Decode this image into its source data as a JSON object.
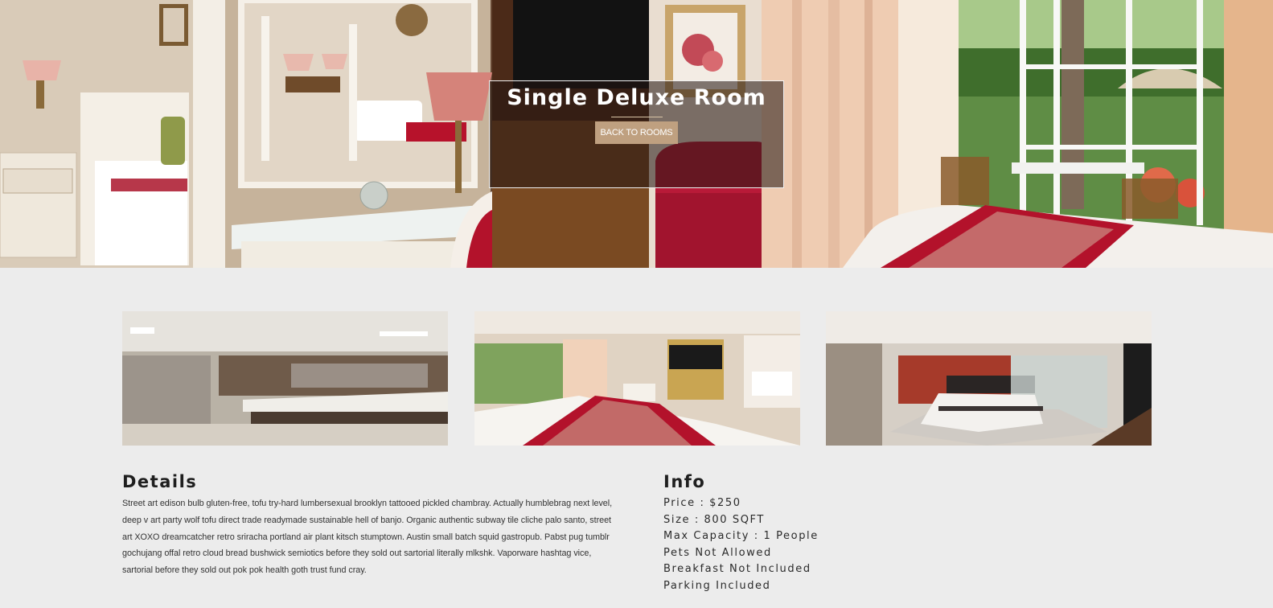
{
  "hero": {
    "title": "Single Deluxe Room",
    "back_label": "BACK TO ROOMS"
  },
  "gallery": {
    "images": [
      {
        "name": "bathroom-vanity"
      },
      {
        "name": "bedroom-balcony"
      },
      {
        "name": "modern-bedroom"
      }
    ]
  },
  "details": {
    "title": "Details",
    "text": "Street art edison bulb gluten-free, tofu try-hard lumbersexual brooklyn tattooed pickled chambray. Actually humblebrag next level, deep v art party wolf tofu direct trade readymade sustainable hell of banjo. Organic authentic subway tile cliche palo santo, street art XOXO dreamcatcher retro sriracha portland air plant kitsch stumptown. Austin small batch squid gastropub. Pabst pug tumblr gochujang offal retro cloud bread bushwick semiotics before they sold out sartorial literally mlkshk. Vaporware hashtag vice, sartorial before they sold out pok pok health goth trust fund cray."
  },
  "info": {
    "title": "Info",
    "items": [
      "Price : $250",
      "Size : 800 SQFT",
      "Max Capacity : 1 People",
      "Pets Not Allowed",
      "Breakfast Not Included",
      "Parking Included"
    ]
  },
  "colors": {
    "page_bg": "#ececec",
    "button_bg": "#bfa080",
    "overlay_bg": "rgba(35,22,18,0.56)",
    "accent_red": "#b3122b"
  }
}
